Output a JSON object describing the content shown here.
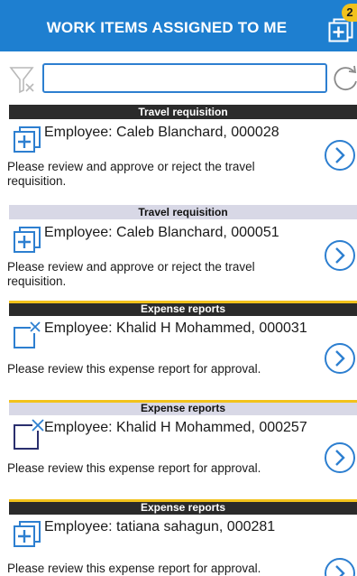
{
  "header": {
    "title": "WORK ITEMS ASSIGNED TO ME",
    "badge": "2",
    "color": "#1e7fd0"
  },
  "toolbar": {
    "search_value": "",
    "search_placeholder": ""
  },
  "items": [
    {
      "category": "Travel requisition",
      "employee": "Employee: Caleb Blanchard, 000028",
      "description": "Please review and approve or reject the travel requisition.",
      "icon": "add-document-icon"
    },
    {
      "category": "Travel requisition",
      "employee": "Employee: Caleb Blanchard, 000051",
      "description": "Please review and approve or reject the travel requisition.",
      "icon": "add-document-icon"
    },
    {
      "category": "Expense reports",
      "employee": "Employee: Khalid H Mohammed, 000031",
      "description": "Please review this expense report for approval.",
      "icon": "expense-report-icon"
    },
    {
      "category": "Expense reports",
      "employee": "Employee: Khalid H Mohammed, 000257",
      "description": "Please review this expense report for approval.",
      "icon": "expense-report-icon"
    },
    {
      "category": "Expense reports",
      "employee": "Employee: tatiana sahagun, 000281",
      "description": "Please review this expense report for approval.",
      "icon": "add-document-icon"
    }
  ],
  "colors": {
    "accent": "#1e7fd0",
    "badge": "#f2c21b",
    "dark_bar": "#2b2b2b",
    "light_bar": "#d8d8e6"
  }
}
